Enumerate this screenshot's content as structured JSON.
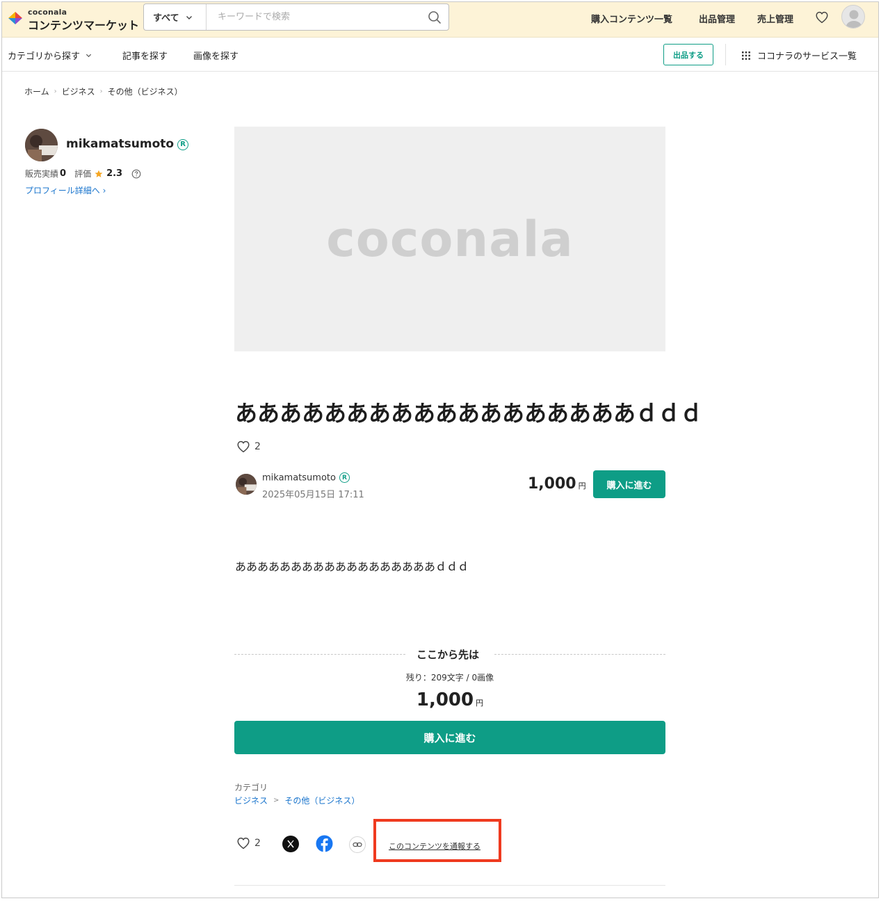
{
  "header": {
    "logo_small": "coconala",
    "logo_main": "コンテンツマーケット",
    "search_category": "すべて",
    "search_placeholder": "キーワードで検索",
    "nav": [
      "購入コンテンツ一覧",
      "出品管理",
      "売上管理"
    ]
  },
  "subnav": {
    "items": [
      "カテゴリから探す",
      "記事を探す",
      "画像を探す"
    ],
    "sell_button": "出品する",
    "services": "ココナラのサービス一覧"
  },
  "breadcrumb": [
    "ホーム",
    "ビジネス",
    "その他（ビジネス）"
  ],
  "profile": {
    "name": "mikamatsumoto",
    "badge": "R",
    "sales_label": "販売実績",
    "sales_value": "0",
    "rating_label": "評価",
    "rating_value": "2.3",
    "link": "プロフィール詳細へ ›"
  },
  "hero": {
    "logo_text": "coconala"
  },
  "content": {
    "title": "ああああああああああああああああああｄｄｄ",
    "likes": "2",
    "author_name": "mikamatsumoto",
    "author_badge": "R",
    "date": "2025年05月15日 17:11",
    "price": "1,000",
    "yen": "円",
    "buy_label": "購入に進む",
    "body": "ああああああああああああああああああｄｄｄ"
  },
  "paywall": {
    "title": "ここから先は",
    "remaining": "残り：209文字 / 0画像",
    "price": "1,000",
    "yen": "円",
    "buy_label": "購入に進む"
  },
  "category": {
    "label": "カテゴリ",
    "links": [
      "ビジネス",
      "その他（ビジネス）"
    ],
    "separator": ">"
  },
  "share": {
    "likes": "2",
    "report": "このコンテンツを通報する"
  },
  "colors": {
    "accent": "#0e9d86",
    "header_bg": "#fdf3d7",
    "link": "#1773cc",
    "highlight": "#ef3a1f"
  }
}
